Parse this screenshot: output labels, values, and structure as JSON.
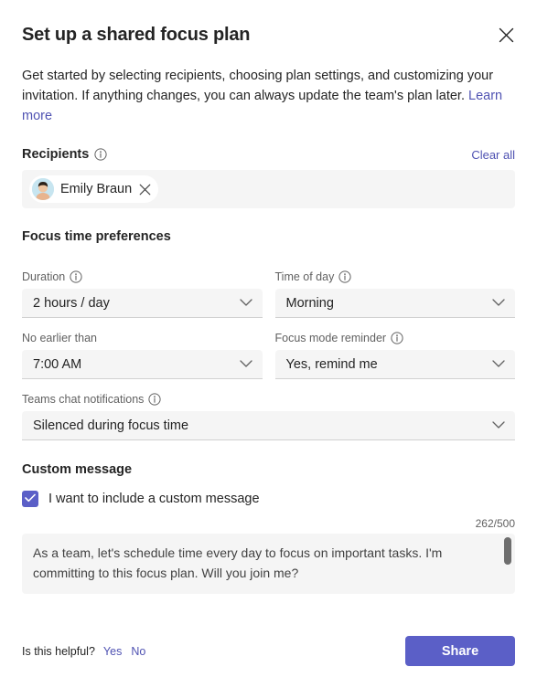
{
  "dialog": {
    "title": "Set up a shared focus plan",
    "close_label": "Close",
    "intro_text": "Get started by selecting recipients, choosing plan settings, and customizing your invitation. If anything changes, you can always update the team's plan later.",
    "intro_link": "Learn more"
  },
  "recipients": {
    "heading": "Recipients",
    "clear_all": "Clear all",
    "chips": [
      {
        "name": "Emily Braun",
        "remove_label": "Remove"
      }
    ]
  },
  "focus_preferences": {
    "heading": "Focus time preferences",
    "fields": [
      {
        "label": "Duration",
        "has_info": true,
        "value": "2 hours / day"
      },
      {
        "label": "Time of day",
        "has_info": true,
        "value": "Morning"
      },
      {
        "label": "No earlier than",
        "has_info": false,
        "value": "7:00 AM"
      },
      {
        "label": "Focus mode reminder",
        "has_info": true,
        "value": "Yes, remind me"
      },
      {
        "label": "Teams chat notifications",
        "has_info": true,
        "value": "Silenced during focus time"
      }
    ]
  },
  "custom_message": {
    "heading": "Custom message",
    "checkbox_label": "I want to include a custom message",
    "checked": true,
    "counter": "262/500",
    "text": "As a team, let's schedule time every day to focus on important tasks. I'm committing to this focus plan. Will you join me?"
  },
  "footer": {
    "helpful_question": "Is this helpful?",
    "yes_label": "Yes",
    "no_label": "No",
    "share_label": "Share"
  },
  "colors": {
    "brand": "#5B5FC7",
    "link": "#4F52B2",
    "field_bg": "#F5F5F5",
    "text": "#242424",
    "muted": "#616161"
  }
}
